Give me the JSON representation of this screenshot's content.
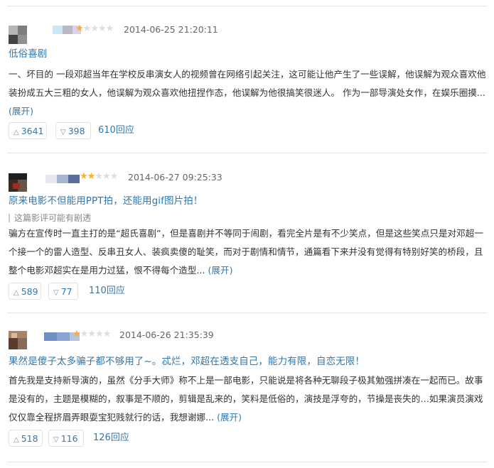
{
  "reviews": [
    {
      "rating": 1,
      "time": "2014-06-25 21:20:11",
      "title": "低俗喜剧",
      "spoiler": "",
      "content": "一、坏目的 一段邓超当年在学校反串演女人的视频曾在网络引起关注，这可能让他产生了一些误解，他误解为观众喜欢他装扮成五大三粗的女人，他误解为观众喜欢他扭捏作态，他误解为他很搞笑很迷人。 作为一部导演处女作，在娱乐圈摸... ",
      "expand": "(展开)",
      "useful": "3641",
      "useless": "398",
      "replies": "610回应"
    },
    {
      "rating": 2,
      "time": "2014-06-27 09:25:33",
      "title": "原来电影不但能用PPT拍，还能用gif图片拍！",
      "spoiler": "这篇影评可能有剧透",
      "content": "骗方在宣传时一直主打的是“超氏喜剧”，但是喜剧并不等同于闹剧，看完全片是有不少笑点，但是这些笑点只是对邓超一个接一个的雷人造型、反串丑女人、装疯卖傻的耻笑，而对于剧情和情节，通篇看下来并没有觉得有特别好笑的桥段，且整个电影邓超实在是用力过猛，恨不得每个造型... ",
      "expand": "(展开)",
      "useful": "589",
      "useless": "77",
      "replies": "110回应"
    },
    {
      "rating": 1,
      "time": "2014-06-26 21:35:39",
      "title": "果然是傻子太多骗子都不够用了~。忒烂，邓超在透支自己，能力有限，自恋无限！",
      "spoiler": "",
      "content": "首先我是支持新导演的，虽然《分手大师》称不上是一部电影，只能说是将各种无聊段子极其勉强拼凑在一起而已。故事是没有的，主题是模糊的，叙事是不顺的，剪辑是乱来的，笑料是低俗的，演技是浮夸的，节操是丧失的…如果演员演戏仅仅靠全程挤眉弄眼耍宝犯贱就行的话，我想谢娜... ",
      "expand": "(展开)",
      "useful": "518",
      "useless": "116",
      "replies": "126回应"
    }
  ],
  "icons": {
    "star_filled": "★",
    "star_empty": "★",
    "up_arrow": "△",
    "down_arrow": "▽"
  },
  "colors": {
    "link": "#3377aa",
    "star": "#ffac2d",
    "star_empty": "#dddddd",
    "divider": "#e5e5e5"
  }
}
